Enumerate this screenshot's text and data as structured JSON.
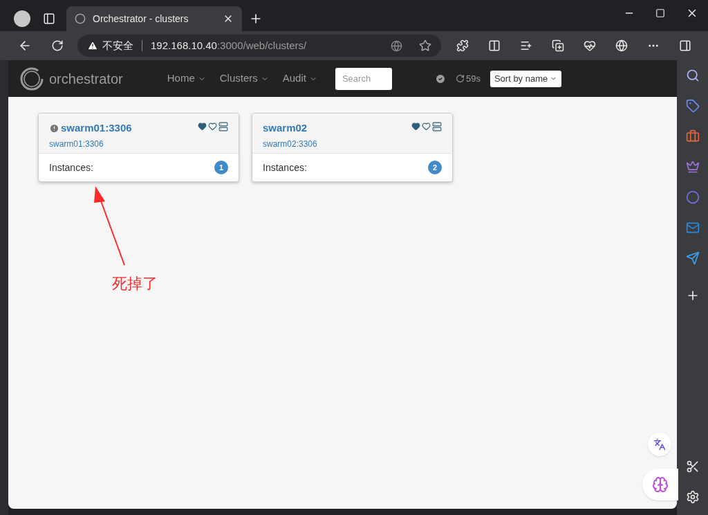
{
  "browser": {
    "tab": {
      "title": "Orchestrator - clusters"
    },
    "address": {
      "security": "不安全",
      "host": "192.168.10.40",
      "path": ":3000/web/clusters/"
    }
  },
  "navbar": {
    "brand": "orchestrator",
    "menus": [
      {
        "label": "Home"
      },
      {
        "label": "Clusters"
      },
      {
        "label": "Audit"
      }
    ],
    "search": {
      "placeholder": "Search"
    },
    "refresh": "59s",
    "sort": "Sort by name"
  },
  "clusters": [
    {
      "title": "swarm01:3306",
      "alias": "swarm01:3306",
      "warning": true,
      "instances_label": "Instances:",
      "count": "1"
    },
    {
      "title": "swarm02",
      "alias": "swarm02:3306",
      "warning": false,
      "instances_label": "Instances:",
      "count": "2"
    }
  ],
  "annotation": {
    "text": "死掉了"
  }
}
